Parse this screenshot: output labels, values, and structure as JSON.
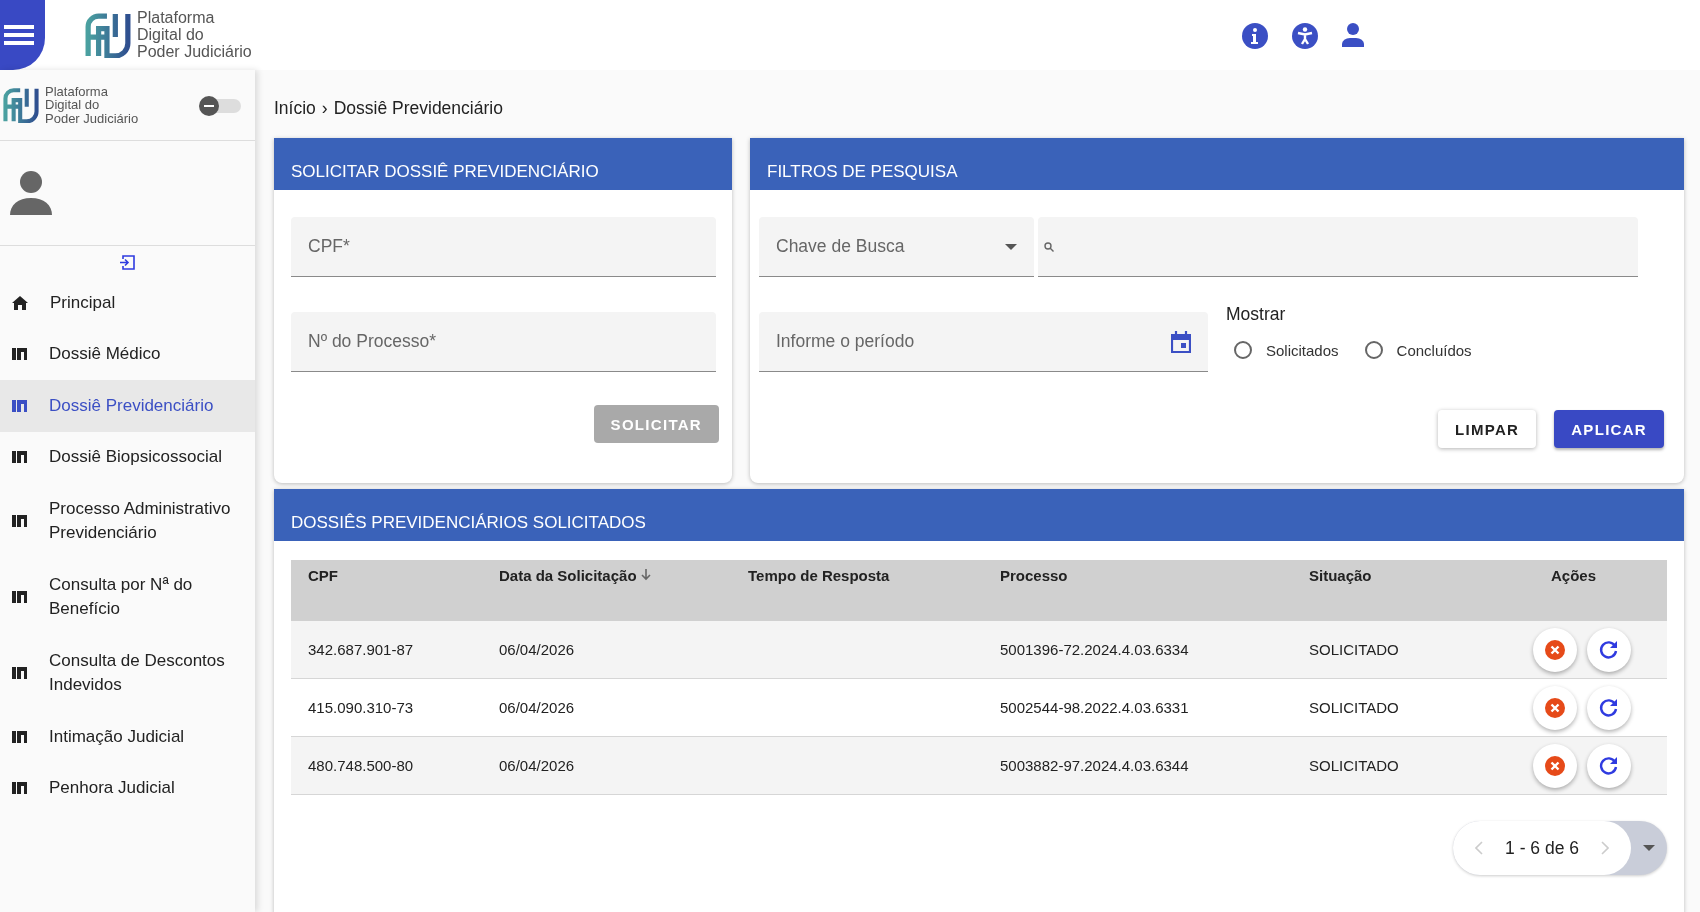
{
  "topbar": {
    "logo_lines": [
      "Plataforma",
      "Digital do",
      "Poder Judiciário"
    ]
  },
  "sidebar": {
    "logo_lines": [
      "Plataforma",
      "Digital do",
      "Poder Judiciário"
    ],
    "toggle": {
      "on": false
    },
    "items": [
      {
        "kind": "home",
        "label": "Principal",
        "selected": false
      },
      {
        "kind": "chart",
        "label": "Dossiê Médico",
        "selected": false
      },
      {
        "kind": "chart",
        "label": "Dossiê Previdenciário",
        "selected": true
      },
      {
        "kind": "chart",
        "label": "Dossiê Biopsicossocial",
        "selected": false
      },
      {
        "kind": "chart",
        "label": "Processo Administrativo Previdenciário",
        "selected": false
      },
      {
        "kind": "chart",
        "label": "Consulta por Nª do Benefício",
        "selected": false
      },
      {
        "kind": "chart",
        "label": "Consulta de Descontos Indevidos",
        "selected": false
      },
      {
        "kind": "chart",
        "label": "Intimação Judicial",
        "selected": false
      },
      {
        "kind": "chart",
        "label": "Penhora Judicial",
        "selected": false
      }
    ]
  },
  "breadcrumb": [
    "Início",
    "›",
    "Dossiê Previdenciário"
  ],
  "request_panel": {
    "title": "SOLICITAR DOSSIÊ PREVIDENCIÁRIO",
    "fields": [
      {
        "placeholder": "CPF*"
      },
      {
        "placeholder": "Nº do Processo*"
      }
    ],
    "button": {
      "label": "SOLICITAR",
      "disabled": true
    }
  },
  "filter_panel": {
    "title": "FILTROS DE PESQUISA",
    "select": {
      "placeholder": "Chave de Busca"
    },
    "period": {
      "placeholder": "Informe o período"
    },
    "show_label": "Mostrar",
    "radios": [
      {
        "label": "Solicitados",
        "selected": false
      },
      {
        "label": "Concluídos",
        "selected": false
      }
    ],
    "buttons": [
      {
        "kind": "outline",
        "label": "LIMPAR"
      },
      {
        "kind": "primary",
        "label": "APLICAR"
      }
    ]
  },
  "results": {
    "title": "DOSSIÊS PREVIDENCIÁRIOS SOLICITADOS",
    "columns": [
      {
        "label": "CPF",
        "sorted": false
      },
      {
        "label": "Data da Solicitação",
        "sorted": true
      },
      {
        "label": "Tempo de Resposta",
        "sorted": false
      },
      {
        "label": "Processo",
        "sorted": false
      },
      {
        "label": "Situação",
        "sorted": false
      },
      {
        "label": "Ações",
        "sorted": false
      }
    ],
    "rows": [
      {
        "cpf": "342.687.901-87",
        "date": "06/04/2026",
        "process": "5001396-72.2024.4.03.6334",
        "status": "SOLICITADO"
      },
      {
        "cpf": "415.090.310-73",
        "date": "06/04/2026",
        "process": "5002544-98.2022.4.03.6331",
        "status": "SOLICITADO"
      },
      {
        "cpf": "480.748.500-80",
        "date": "06/04/2026",
        "process": "5003882-97.2024.4.03.6344",
        "status": "SOLICITADO"
      }
    ],
    "pagination": "1 - 6 de 6"
  }
}
